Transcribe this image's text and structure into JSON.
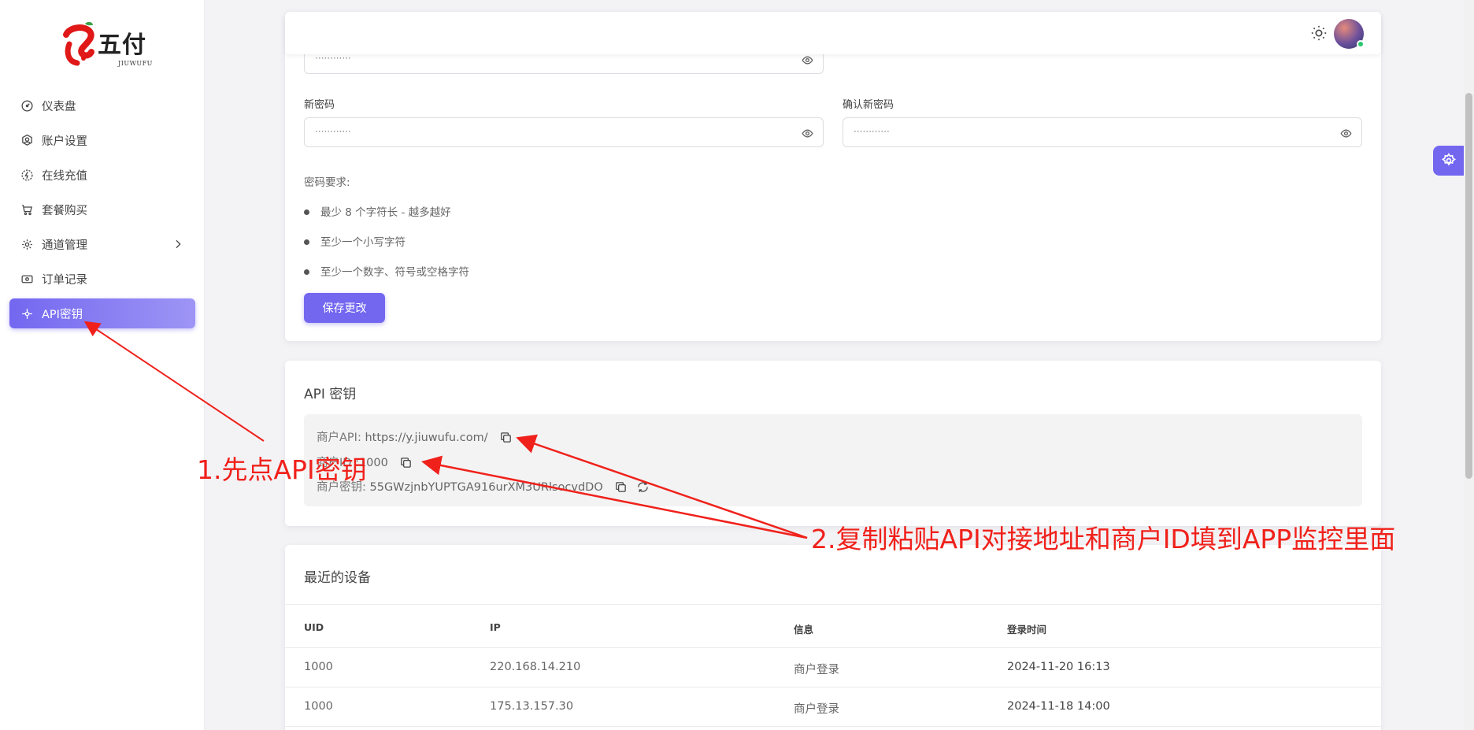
{
  "brand": {
    "name": "五付",
    "sub": "JIUWUFU",
    "mark": "九"
  },
  "sidebar": {
    "items": [
      {
        "label": "仪表盘",
        "icon": "dashboard-icon"
      },
      {
        "label": "账户设置",
        "icon": "user-settings-icon"
      },
      {
        "label": "在线充值",
        "icon": "recharge-icon"
      },
      {
        "label": "套餐购买",
        "icon": "cart-icon"
      },
      {
        "label": "通道管理",
        "icon": "channel-gear-icon",
        "has_submenu": true
      },
      {
        "label": "订单记录",
        "icon": "order-icon"
      },
      {
        "label": "API密钥",
        "icon": "api-key-icon",
        "active": true
      }
    ]
  },
  "password": {
    "current_value": "············",
    "new_label": "新密码",
    "new_value": "············",
    "confirm_label": "确认新密码",
    "confirm_value": "············",
    "requirements_title": "密码要求:",
    "requirements": [
      "最少 8 个字符长 - 越多越好",
      "至少一个小写字符",
      "至少一个数字、符号或空格字符"
    ],
    "save_label": "保存更改"
  },
  "api": {
    "title": "API 密钥",
    "merchant_api_label": "商户API:",
    "merchant_api_value": "https://y.jiuwufu.com/",
    "merchant_id_label": "商户ID",
    "merchant_id_value": ":1000",
    "merchant_key_label": "商户密钥:",
    "merchant_key_value": "55GWzjnbYUPTGA916urXM3URlsocvdDO"
  },
  "devices": {
    "title": "最近的设备",
    "columns": [
      "UID",
      "IP",
      "信息",
      "登录时间"
    ],
    "rows": [
      [
        "1000",
        "220.168.14.210",
        "商户登录",
        "2024-11-20 16:13"
      ],
      [
        "1000",
        "175.13.157.30",
        "商户登录",
        "2024-11-18 14:00"
      ]
    ]
  },
  "annotations": {
    "step1": "1.先点API密钥",
    "step2": "2.复制粘贴API对接地址和商户ID填到APP监控里面"
  },
  "colors": {
    "accent": "#7367f0",
    "annotation": "#f0211b"
  }
}
